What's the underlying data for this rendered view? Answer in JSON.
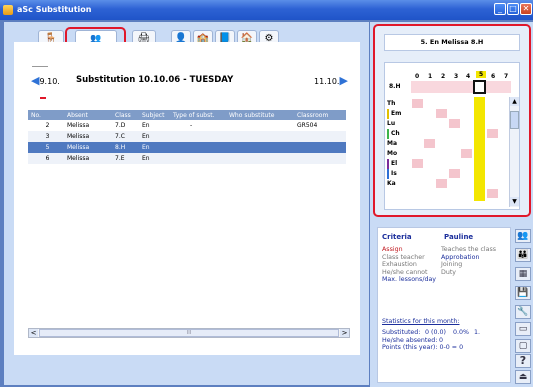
{
  "window": {
    "title": "aSc Substitution",
    "controls": {
      "minimize": "_",
      "maximize": "□",
      "close": "✕"
    }
  },
  "toolbar": {
    "tabs": [
      "tab-general",
      "tab-substitutions",
      "tab-printer",
      "tab-teachers",
      "tab-classes",
      "tab-subjects",
      "tab-rooms",
      "tab-settings"
    ]
  },
  "navigation": {
    "prev_date": "9.10.",
    "title": "Substitution 10.10.06 - TUESDAY",
    "next_date": "11.10."
  },
  "table": {
    "columns": [
      "No.",
      "Absent",
      "Class",
      "Subject",
      "Type of subst.",
      "Who substitute",
      "Classroom"
    ],
    "rows": [
      [
        "2",
        "Melissa",
        "7.D",
        "En",
        "-",
        "",
        "GR504"
      ],
      [
        "3",
        "Melissa",
        "7.C",
        "En",
        "",
        "",
        ""
      ],
      [
        "5",
        "Melissa",
        "8.H",
        "En",
        "",
        "",
        ""
      ],
      [
        "6",
        "Melissa",
        "7.E",
        "En",
        "",
        "",
        ""
      ]
    ],
    "selected_row": 2
  },
  "scrollbar": {
    "left": "<",
    "right": ">",
    "grip": "III"
  },
  "schedule": {
    "header": "5. En Melissa 8.H",
    "corner": "8.H",
    "periods": [
      "0",
      "1",
      "2",
      "3",
      "4",
      "5",
      "6",
      "7"
    ],
    "highlight_period": "5",
    "teachers": [
      "Th",
      "Em",
      "Lu",
      "Ch",
      "Ma",
      "Mo",
      "El",
      "Is",
      "Ka"
    ]
  },
  "criteria": {
    "heading": "Criteria",
    "name": "Pauline",
    "left": [
      "Assign",
      "Class teacher",
      "Exhaustion",
      "He/she cannot",
      "Max. lessons/day"
    ],
    "right": [
      "Teaches the class",
      "Approbation",
      "Joining",
      "Duty"
    ],
    "stats_heading": "Statistics for this month:",
    "stat_lines": [
      {
        "label": "Substituted:",
        "value": "0 (0.0)",
        "pct": "0.0%",
        "n": "1."
      },
      {
        "label": "He/she absented:",
        "value": "0",
        "pct": "",
        "n": ""
      },
      {
        "label": "Points (this year):",
        "value": "0-0 = 0",
        "pct": "",
        "n": ""
      }
    ]
  },
  "side_toolbar": [
    "people-icon",
    "group-icon",
    "table-icon",
    "save-icon",
    "wrench-icon",
    "window-icon",
    "window2-icon",
    "help-icon",
    "exit-icon"
  ],
  "colors": {
    "accent": "#2f72d6",
    "highlight": "#4f79c0",
    "red": "#e0182a"
  }
}
